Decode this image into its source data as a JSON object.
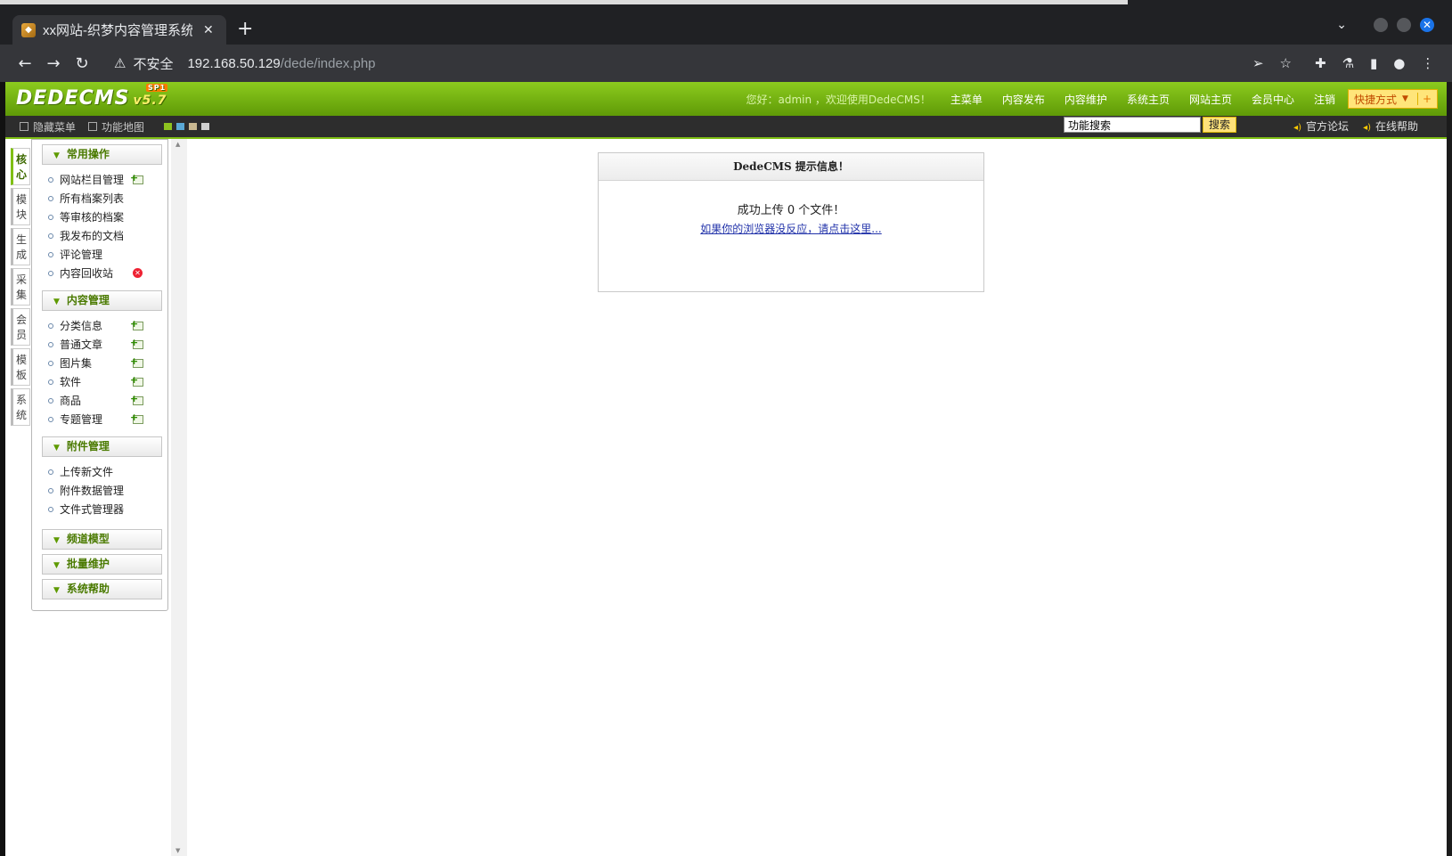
{
  "browser": {
    "tab_title": "xx网站-织梦内容管理系统",
    "tab_close": "✕",
    "new_tab": "+",
    "insecure_label": "不安全",
    "url_host": "192.168.50.129",
    "url_path": "/dede/index.php"
  },
  "header": {
    "logo_text": "DEDECMS",
    "logo_version": "v5.7",
    "logo_badge": "SP1",
    "welcome": "您好：admin ，欢迎使用DedeCMS！",
    "nav": [
      "主菜单",
      "内容发布",
      "内容维护",
      "系统主页",
      "网站主页",
      "会员中心",
      "注销"
    ],
    "quick_label": "快捷方式",
    "quick_plus": "+"
  },
  "subbar": {
    "hide_menu": "隐藏菜单",
    "site_map": "功能地图",
    "swatch_colors": [
      "#8dc21f",
      "#5aa9d6",
      "#c9b891",
      "#d0d0d0"
    ],
    "search_value": "功能搜索",
    "search_button": "搜索",
    "forum": "官方论坛",
    "help": "在线帮助"
  },
  "vtabs": [
    {
      "label": "核心",
      "active": true
    },
    {
      "label": "模块"
    },
    {
      "label": "生成"
    },
    {
      "label": "采集"
    },
    {
      "label": "会员"
    },
    {
      "label": "模板"
    },
    {
      "label": "系统"
    }
  ],
  "menu": {
    "groups": [
      {
        "title": "常用操作",
        "items": [
          "网站栏目管理",
          "所有档案列表",
          "等审核的档案",
          "我发布的文档",
          "评论管理",
          "内容回收站"
        ]
      },
      {
        "title": "内容管理",
        "items": [
          "分类信息",
          "普通文章",
          "图片集",
          "软件",
          "商品",
          "专题管理"
        ]
      },
      {
        "title": "附件管理",
        "items": [
          "上传新文件",
          "附件数据管理",
          "文件式管理器"
        ]
      },
      {
        "title": "频道模型"
      },
      {
        "title": "批量维护"
      },
      {
        "title": "系统帮助"
      }
    ]
  },
  "message": {
    "title": "DedeCMS 提示信息！",
    "text": "成功上传 0 个文件！",
    "link": "如果你的浏览器没反应，请点击这里..."
  }
}
